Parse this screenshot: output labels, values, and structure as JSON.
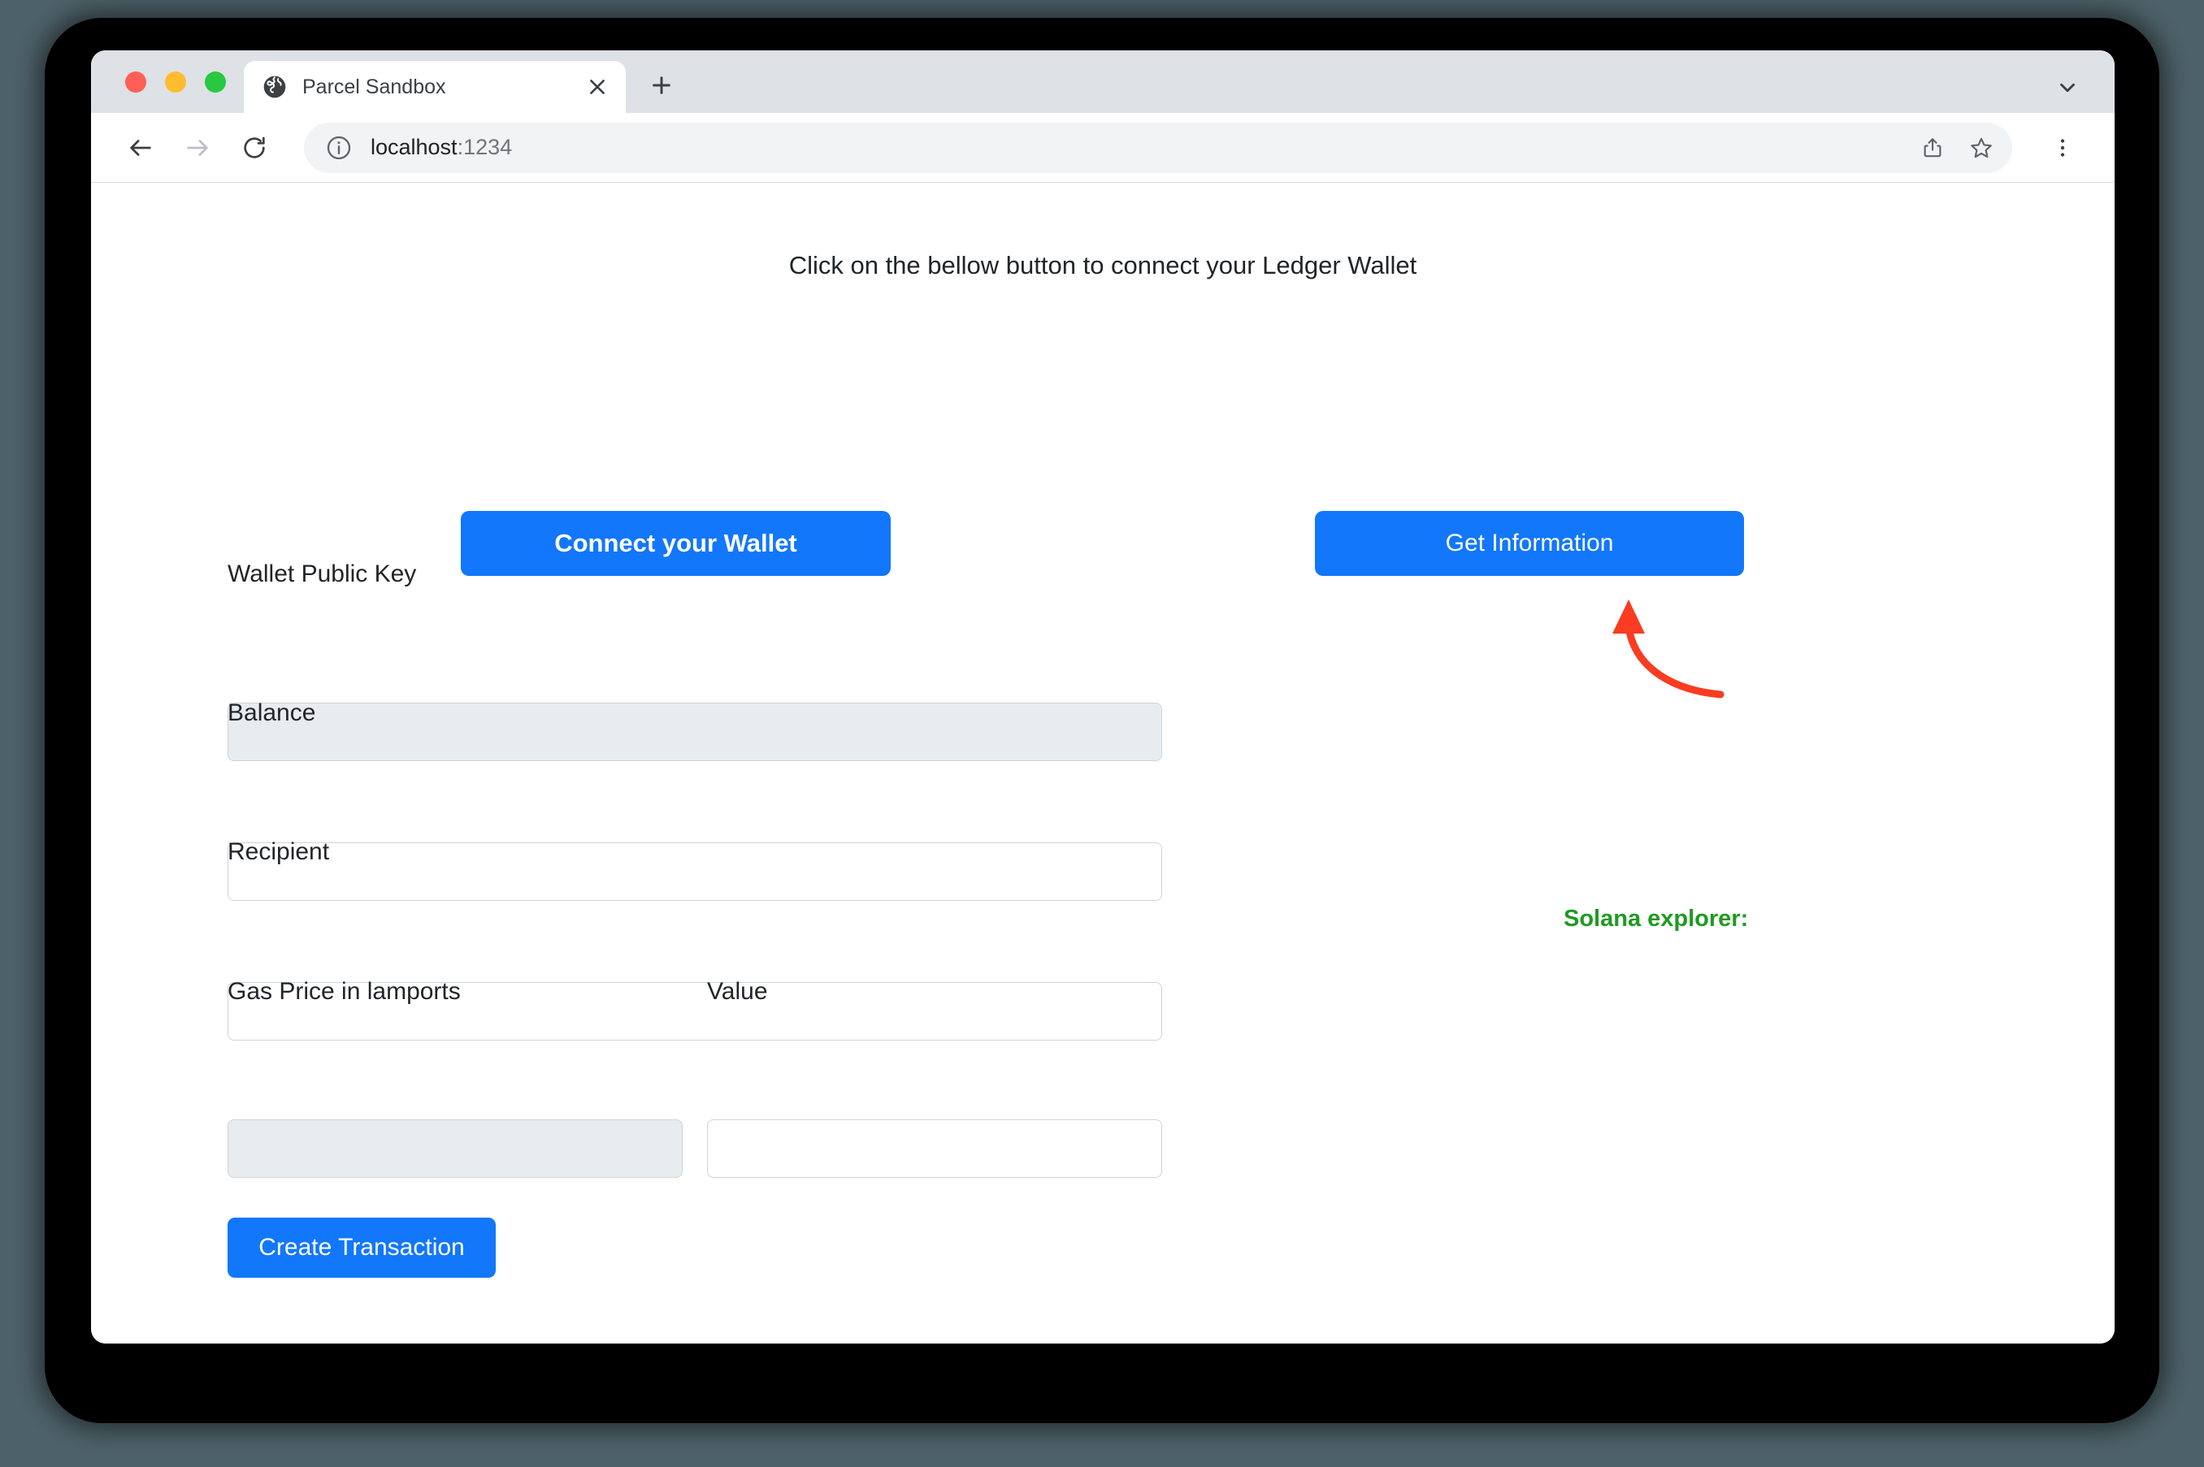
{
  "window": {
    "traffic_lights": [
      "close",
      "minimize",
      "maximize"
    ]
  },
  "tabstrip": {
    "tab": {
      "title": "Parcel Sandbox",
      "favicon": "globe-icon",
      "close_icon": "close-icon"
    },
    "new_tab_icon": "plus-icon",
    "tab_list_icon": "chevron-down-icon"
  },
  "toolbar": {
    "back_icon": "arrow-left-icon",
    "forward_icon": "arrow-right-icon",
    "reload_icon": "reload-icon",
    "site_info_icon": "info-circle-icon",
    "url_host": "localhost",
    "url_port": ":1234",
    "share_icon": "share-icon",
    "bookmark_icon": "star-icon",
    "menu_icon": "three-dot-menu-icon"
  },
  "page": {
    "heading": "Click on the bellow button to connect your Ledger Wallet",
    "connect_wallet_label": "Connect your Wallet",
    "get_information_label": "Get Information",
    "create_transaction_label": "Create Transaction",
    "solana_explorer_label": "Solana explorer:",
    "fields": {
      "wallet_public_key": {
        "label": "Wallet Public Key",
        "value": "",
        "placeholder": "",
        "disabled": true
      },
      "balance": {
        "label": "Balance",
        "value": "",
        "placeholder": "",
        "disabled": false
      },
      "recipient": {
        "label": "Recipient",
        "value": "",
        "placeholder": "",
        "disabled": false
      },
      "gas_price": {
        "label": "Gas Price in lamports",
        "value": "",
        "placeholder": "",
        "disabled": true
      },
      "value": {
        "label": "Value",
        "value": "",
        "placeholder": "",
        "disabled": false
      }
    }
  },
  "annotation": {
    "arrow_color": "#f93c22",
    "arrow_target": "get-information-button"
  },
  "colors": {
    "accent_blue": "#1277fb",
    "explorer_green": "#1f9a21",
    "annotation_red": "#f93c22",
    "tabstrip_gray": "#dee1e6",
    "disabled_input": "#e9ecef",
    "input_border": "#ced4da"
  }
}
